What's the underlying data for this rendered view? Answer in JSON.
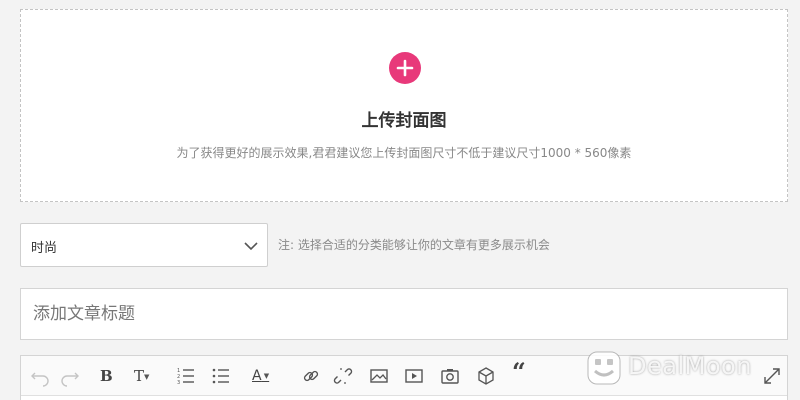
{
  "upload": {
    "title": "上传封面图",
    "hint": "为了获得更好的展示效果,君君建议您上传封面图尺寸不低于建议尺寸1000 * 560像素",
    "icon": "plus-icon",
    "accent_color": "#e8397a"
  },
  "category": {
    "selected": "时尚",
    "note": "注: 选择合适的分类能够让你的文章有更多展示机会"
  },
  "title_input": {
    "placeholder": "添加文章标题",
    "value": ""
  },
  "toolbar": {
    "items": [
      "undo-icon",
      "redo-icon",
      "bold-icon",
      "text-size-icon",
      "ordered-list-icon",
      "unordered-list-icon",
      "font-color-icon",
      "link-icon",
      "unlink-icon",
      "image-icon",
      "video-icon",
      "camera-icon",
      "embed-box-icon",
      "quote-icon",
      "fullscreen-icon"
    ],
    "bold_label": "B",
    "text_size_label": "T",
    "font_color_label": "A",
    "quote_label": "“"
  },
  "watermark": {
    "text": "DealMoon",
    "icon": "dealmoon-logo-icon"
  }
}
